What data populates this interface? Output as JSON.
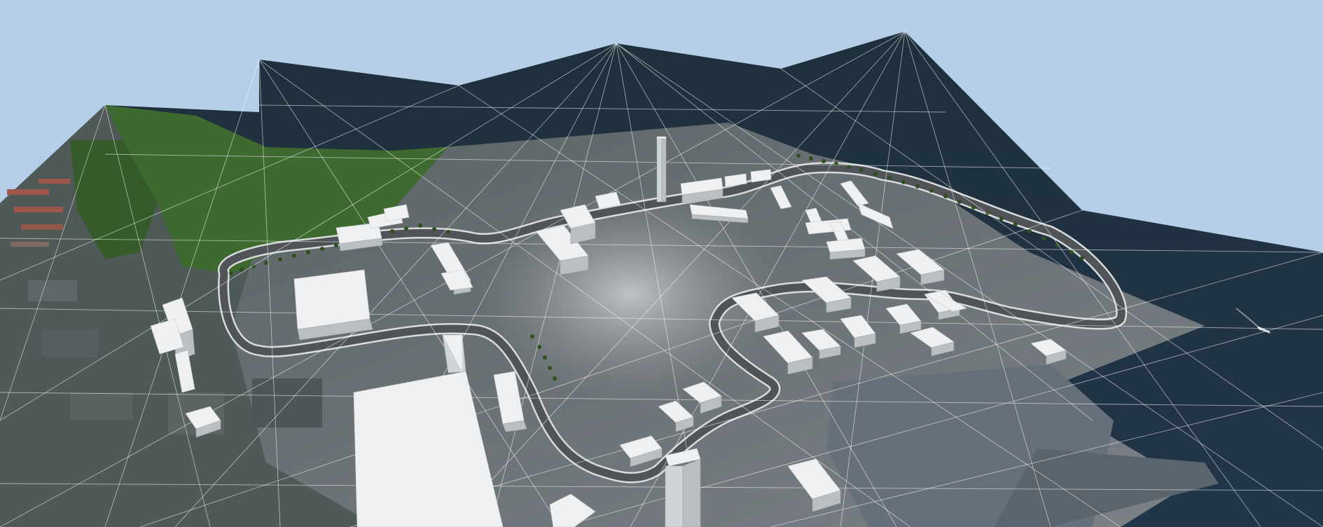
{
  "viewer": {
    "sky_color": "#b5cfe8",
    "water_color": "#1b2b35",
    "terrain_color": "#6b7077",
    "grass_color": "#3f6a2f",
    "track_color": "#505357",
    "track_edge_color": "#d9dcdd",
    "building_color": "#e6e9ea",
    "wireframe_color": "#ffffff"
  },
  "icons": {
    "boat": "boat-icon"
  }
}
